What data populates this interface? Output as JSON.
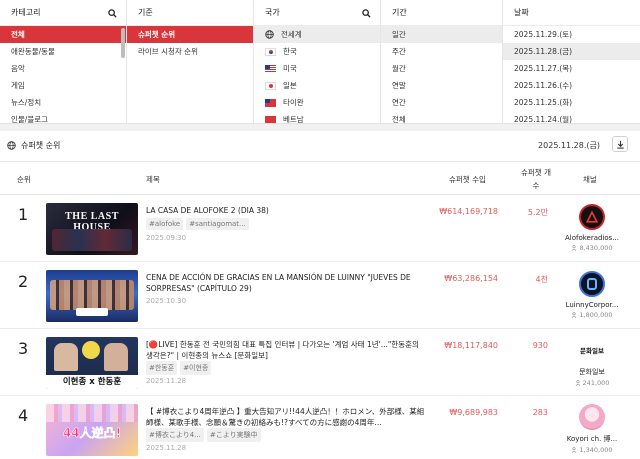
{
  "filters": {
    "category": {
      "header": "카테고리",
      "items": [
        "전체",
        "애완동물/동물",
        "음악",
        "게임",
        "뉴스/정치",
        "인물/블로그"
      ]
    },
    "criteria": {
      "header": "기준",
      "items": [
        "슈퍼챗 순위",
        "라이브 시청자 순위"
      ]
    },
    "country": {
      "header": "국가",
      "items": [
        "전세계",
        "한국",
        "미국",
        "일본",
        "타이완",
        "베트남"
      ]
    },
    "period": {
      "header": "기간",
      "items": [
        "일간",
        "주간",
        "월간",
        "연말",
        "연간",
        "전체"
      ]
    },
    "date": {
      "header": "날짜",
      "items": [
        "2025.11.29.(토)",
        "2025.11.28.(금)",
        "2025.11.27.(목)",
        "2025.11.26.(수)",
        "2025.11.25.(화)",
        "2025.11.24.(월)"
      ]
    }
  },
  "ranking": {
    "title": "슈퍼챗 순위",
    "date": "2025.11.28.(금)",
    "columns": {
      "rank": "순위",
      "title": "제목",
      "income": "슈퍼챗 수입",
      "count_line1": "슈퍼챗 개",
      "count_line2": "수",
      "channel": "채널"
    },
    "rows": [
      {
        "rank": "1",
        "title": "LA CASA DE ALOFOKE 2 (DIA 38)",
        "tags": [
          "#alofoke",
          "#santiagomat..."
        ],
        "date": "2025.09.30",
        "income": "₩614,169,718",
        "count": "5.2만",
        "channel": "Alofokeradios...",
        "subs": "8,430,000",
        "thumb_text": "THE LAST HOUSE"
      },
      {
        "rank": "2",
        "title": "CENA DE ACCIÓN DE GRACIAS EN LA MANSIÓN DE LUINNY \"JUEVES DE SORPRESAS\" (CAPÍTULO 29)",
        "tags": [],
        "date": "2025.10.30",
        "income": "₩63,286,154",
        "count": "4천",
        "channel": "LuinnyCorpor...",
        "subs": "1,800,000",
        "thumb_text": ""
      },
      {
        "rank": "3",
        "title": "[🔴LIVE] 한동훈 전 국민의힘 대표 특집 인터뷰 | 다가오는 '계엄 사태 1년'...\"한동훈의 생각은?\" | 이현종의 뉴스쇼 [문화일보]",
        "tags": [
          "#한동훈",
          "#이현종"
        ],
        "date": "2025.11.28",
        "income": "₩18,117,840",
        "count": "930",
        "channel": "문화일보",
        "subs": "241,000",
        "thumb_text": "이현종 x 한동훈",
        "logo_text": "문화일보"
      },
      {
        "rank": "4",
        "title": "【 #博衣こより4周年逆凸 】重大告知アリ!!44人逆凸！！ホロメン、外部様、某組師様、某歌手様、念願＆驚きの初絡みも!?すべての方に感謝の4周年...",
        "tags": [
          "#博衣こより4...",
          "#こより実験中"
        ],
        "date": "2025.11.28",
        "income": "₩9,689,983",
        "count": "283",
        "channel": "Koyori ch. 博...",
        "subs": "1,340,000",
        "thumb_text": "44人逆凸!"
      }
    ]
  },
  "colors": {
    "accent": "#d9363b",
    "income": "#e05b5b",
    "selected_gray": "#ececec"
  }
}
